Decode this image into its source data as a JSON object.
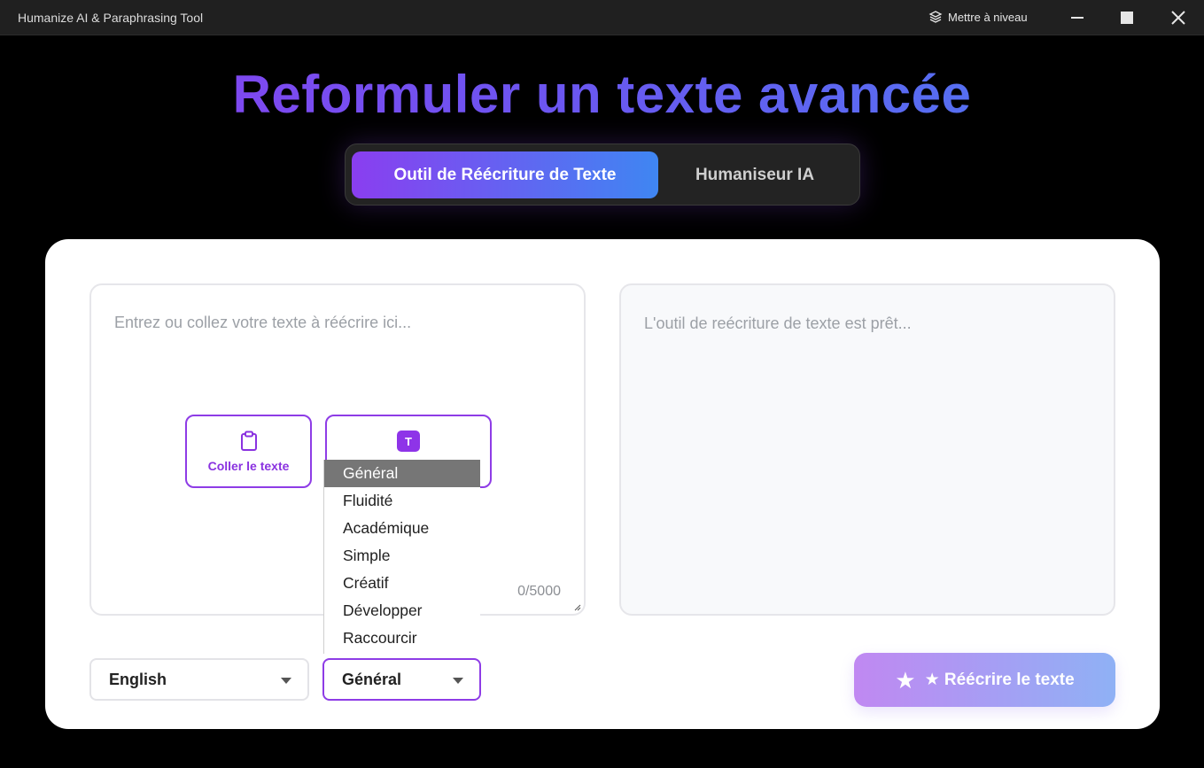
{
  "window": {
    "title": "Humanize AI & Paraphrasing Tool",
    "upgrade_label": "Mettre à niveau",
    "upgrade_icon": "layers-icon"
  },
  "heading": "Reformuler un texte avancée",
  "tabs": [
    {
      "label": "Outil de Réécriture de Texte",
      "active": true
    },
    {
      "label": "Humaniseur IA",
      "active": false
    }
  ],
  "input": {
    "placeholder": "Entrez ou collez votre texte à réécrire ici...",
    "char_count": "0/5000",
    "paste_button_label": "Coller le texte",
    "style_icon_letter": "T"
  },
  "output": {
    "placeholder": "L'outil de reécriture de texte est prêt..."
  },
  "language_select": {
    "value": "English"
  },
  "mode_select": {
    "value": "Général",
    "options": [
      "Général",
      "Fluidité",
      "Académique",
      "Simple",
      "Créatif",
      "Développer",
      "Raccourcir"
    ],
    "highlighted_index": 0
  },
  "rewrite_button": {
    "star": "★",
    "label": "★ Réécrire le texte"
  },
  "colors": {
    "accent_purple": "#8e3ce6",
    "accent_blue": "#3f86f2",
    "background": "#000000",
    "card": "#ffffff"
  }
}
